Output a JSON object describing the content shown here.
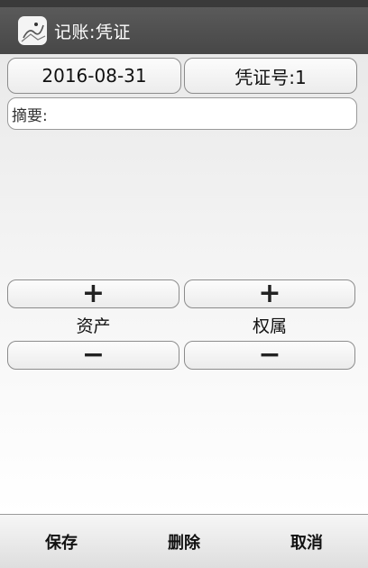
{
  "window": {
    "title": "记账:凭证",
    "icon": "app-logo-icon"
  },
  "header": {
    "date": "2016-08-31",
    "voucher_label": "凭证号:1"
  },
  "summary": {
    "label": "摘要:"
  },
  "columns": {
    "left": {
      "label": "资产",
      "add_symbol": "+",
      "remove_symbol": "−"
    },
    "right": {
      "label": "权属",
      "add_symbol": "+",
      "remove_symbol": "−"
    }
  },
  "toolbar": {
    "save_label": "保存",
    "delete_label": "删除",
    "cancel_label": "取消"
  }
}
